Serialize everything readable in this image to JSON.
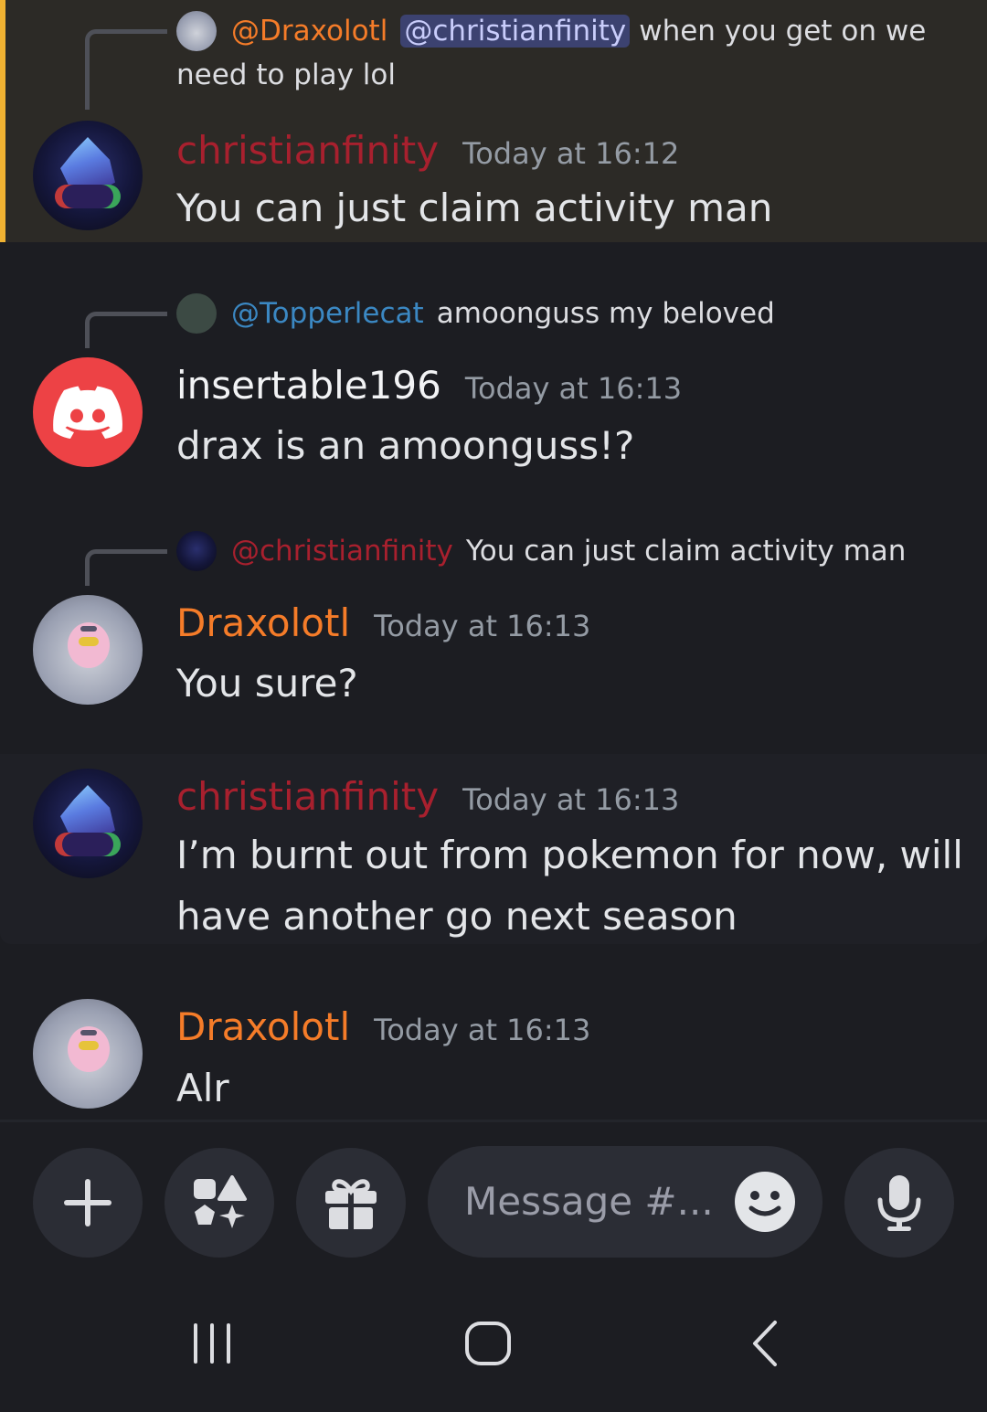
{
  "messages": [
    {
      "reply": {
        "mention": "@Draxolotl",
        "highlight_mention": "@christianfinity",
        "text": "when you get on we",
        "text2": "need to play lol"
      },
      "author": "christianfinity",
      "timestamp": "Today at 16:12",
      "text": "You can just claim activity man"
    },
    {
      "reply": {
        "mention": "@Topperlecat",
        "text": "amoonguss my beloved"
      },
      "author": "insertable196",
      "timestamp": "Today at 16:13",
      "text": "drax is an amoonguss!?"
    },
    {
      "reply": {
        "mention": "@christianfinity",
        "text": "You can just claim activity man"
      },
      "author": "Draxolotl",
      "timestamp": "Today at 16:13",
      "text": "You sure?"
    },
    {
      "author": "christianfinity",
      "timestamp": "Today at 16:13",
      "text_line1": "I’m burnt out from pokemon for now, will",
      "text_line2": "have another go next season"
    },
    {
      "author": "Draxolotl",
      "timestamp": "Today at 16:13",
      "text": "Alr"
    }
  ],
  "composer": {
    "placeholder": "Message #...",
    "buttons": [
      "plus-icon",
      "apps-icon",
      "gift-icon",
      "emoji-icon",
      "microphone-icon"
    ]
  },
  "navigation": [
    "recent-apps-icon",
    "home-icon",
    "back-icon"
  ],
  "colors": {
    "christianfinity": "#a8202e",
    "draxolotl": "#f57c29",
    "topperlecat": "#3b88c3",
    "highlight_bar": "#f0b232",
    "discord_red": "#ed4245"
  }
}
